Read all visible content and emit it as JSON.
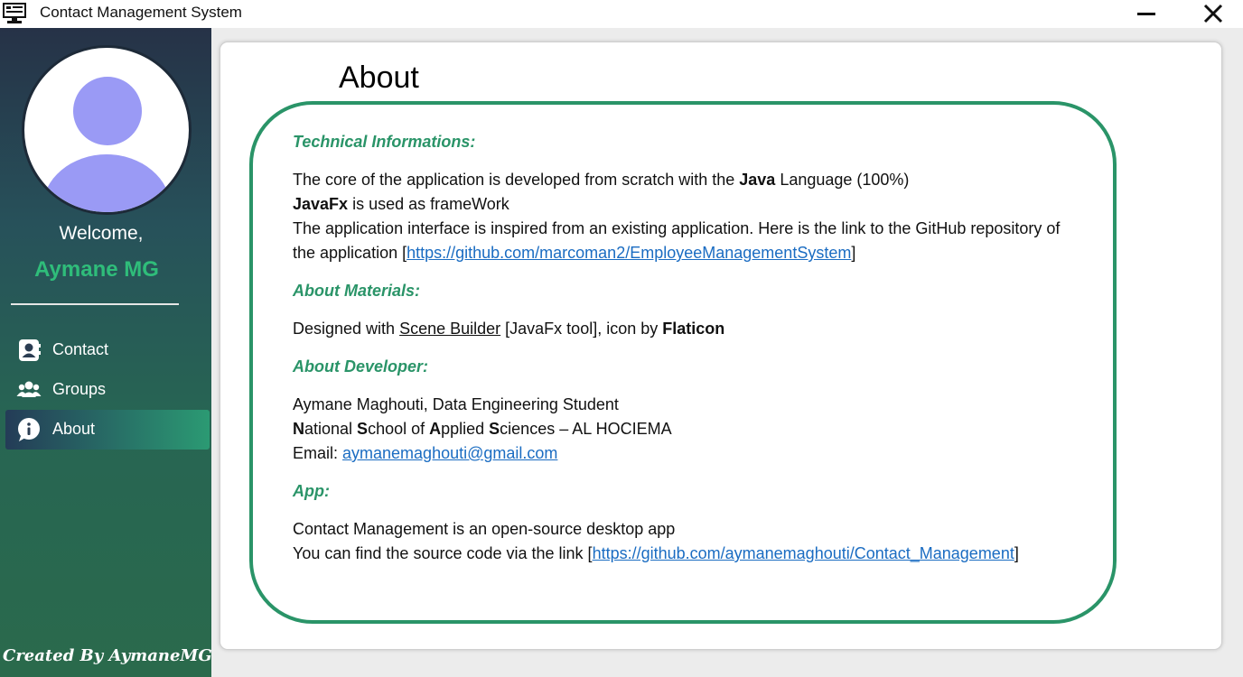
{
  "window": {
    "title": "Contact Management System",
    "icon": "monitor-icon",
    "controls": [
      "minimize-icon",
      "close-icon"
    ]
  },
  "sidebar": {
    "welcome": "Welcome,",
    "username": "Aymane MG",
    "nav": [
      {
        "label": "Contact",
        "icon": "contact-book-icon",
        "active": false
      },
      {
        "label": "Groups",
        "icon": "users-icon",
        "active": false
      },
      {
        "label": "About",
        "icon": "info-icon",
        "active": true
      }
    ],
    "credit": "Created By AymaneMG"
  },
  "about": {
    "heading": "About",
    "technical": {
      "title": "Technical Informations:",
      "line1_pre": "The core of the application is developed from scratch with the ",
      "line1_bold": "Java",
      "line1_post": " Language (100%)",
      "line2_bold": "JavaFx",
      "line2_post": " is used as frameWork",
      "line3": "The application interface is inspired from an existing application. Here is the link to the GitHub repository of",
      "line4_pre": "the application [",
      "line4_link": "https://github.com/marcoman2/EmployeeManagementSystem",
      "line4_post": "]"
    },
    "materials": {
      "title": "About Materials:",
      "pre": "Designed with ",
      "tool": "Scene Builder",
      "mid": " [JavaFx tool], icon by ",
      "bold": "Flaticon"
    },
    "developer": {
      "title": "About Developer:",
      "name_line": "Aymane Maghouti, Data Engineering Student",
      "school": [
        {
          "t": "N",
          "b": true
        },
        {
          "t": "ational ",
          "b": false
        },
        {
          "t": "S",
          "b": true
        },
        {
          "t": "chool of ",
          "b": false
        },
        {
          "t": "A",
          "b": true
        },
        {
          "t": "pplied ",
          "b": false
        },
        {
          "t": "S",
          "b": true
        },
        {
          "t": "ciences – AL HOCIEMA",
          "b": false
        }
      ],
      "email_label": "Email: ",
      "email": "aymanemaghouti@gmail.com"
    },
    "app": {
      "title": "App:",
      "line1": "Contact Management is an open-source desktop app",
      "line2_pre": "You can find the source code via the link [",
      "line2_link": "https://github.com/aymanemaghouti/Contact_Management",
      "line2_post": "]"
    }
  },
  "colors": {
    "accent_green": "#2a9468",
    "username_green": "#2fbd7a",
    "link_blue": "#1a6cc2",
    "avatar_purple": "#9a9af5"
  }
}
